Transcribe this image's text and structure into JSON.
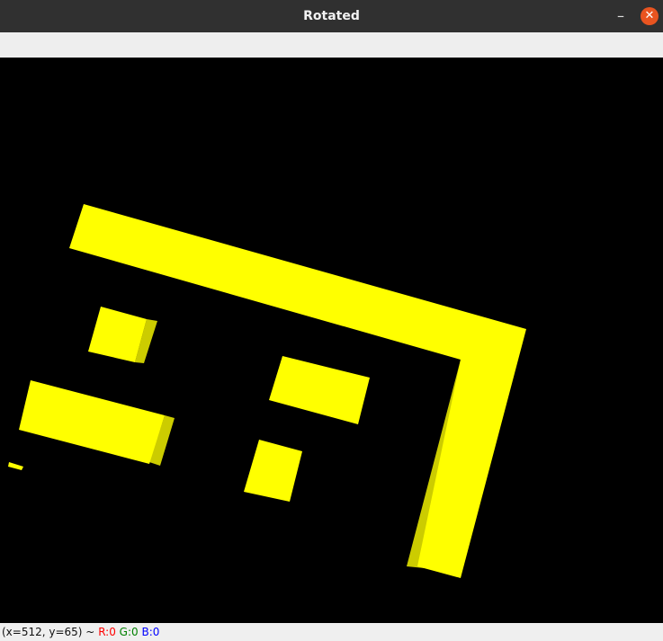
{
  "window": {
    "title": "Rotated"
  },
  "controls": {
    "minimize": "–",
    "close": "✕"
  },
  "image": {
    "background_color": "#000000",
    "shape_color": "#ffff00",
    "shadow_color": "#cccc00",
    "shapes": [
      "l-shaped-bar",
      "small-square",
      "long-block",
      "medium-rectangle",
      "lower-square",
      "small-speck"
    ]
  },
  "status": {
    "coords": "(x=512, y=65) ~",
    "r_label": "R:0",
    "g_label": "G:0",
    "b_label": "B:0",
    "r_color": "#ff0000",
    "g_color": "#008000",
    "b_color": "#0000ff"
  }
}
